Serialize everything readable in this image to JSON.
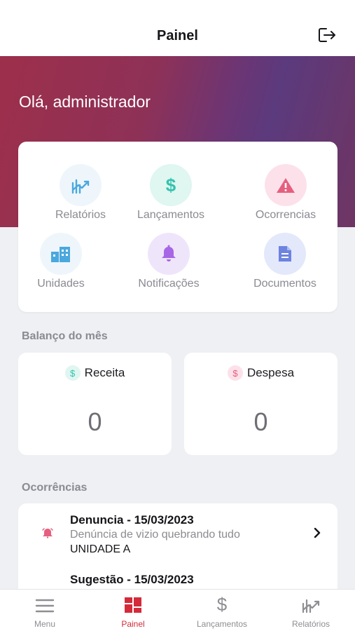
{
  "header": {
    "title": "Painel",
    "logout_icon": "logout-icon"
  },
  "hero": {
    "greeting": "Olá, administrador"
  },
  "quick_actions": [
    {
      "label": "Relatórios",
      "icon": "chart-trend-icon",
      "bg": "#eef6fb",
      "color": "#4aa8de"
    },
    {
      "label": "Lançamentos",
      "icon": "dollar-icon",
      "bg": "#dff6f1",
      "color": "#34c2ad"
    },
    {
      "label": "Ocorrencias",
      "icon": "warning-icon",
      "bg": "#fde1ea",
      "color": "#e5607f"
    },
    {
      "label": "Unidades",
      "icon": "buildings-icon",
      "bg": "#eef6fb",
      "color": "#4aa8de"
    },
    {
      "label": "Notificações",
      "icon": "bell-icon",
      "bg": "#efe5fb",
      "color": "#a766e6"
    },
    {
      "label": "Documentos",
      "icon": "document-icon",
      "bg": "#e3e8fb",
      "color": "#6d83e0"
    }
  ],
  "balance": {
    "title": "Balanço do mês",
    "income": {
      "label": "Receita",
      "value": "0",
      "icon": "dollar-icon",
      "color": "#34c2ad",
      "bg": "#dff6f1"
    },
    "expense": {
      "label": "Despesa",
      "value": "0",
      "icon": "dollar-icon",
      "color": "#e5607f",
      "bg": "#fde1ea"
    }
  },
  "occurrences": {
    "title": "Ocorrências",
    "items": [
      {
        "title": "Denuncia - 15/03/2023",
        "description": "Denúncia de vizio quebrando tudo",
        "unit": "UNIDADE A",
        "icon": "alarm-icon"
      },
      {
        "title": "Sugestão - 15/03/2023",
        "description": "",
        "unit": "",
        "icon": "alarm-icon"
      }
    ]
  },
  "tabs": [
    {
      "label": "Menu",
      "icon": "menu-icon",
      "active": false
    },
    {
      "label": "Painel",
      "icon": "dashboard-icon",
      "active": true
    },
    {
      "label": "Lançamentos",
      "icon": "dollar-icon",
      "active": false
    },
    {
      "label": "Relatórios",
      "icon": "chart-trend-icon",
      "active": false
    }
  ],
  "colors": {
    "accent": "#d42b3a",
    "hero_start": "#9d2f4b",
    "hero_end": "#5b3a7d"
  }
}
